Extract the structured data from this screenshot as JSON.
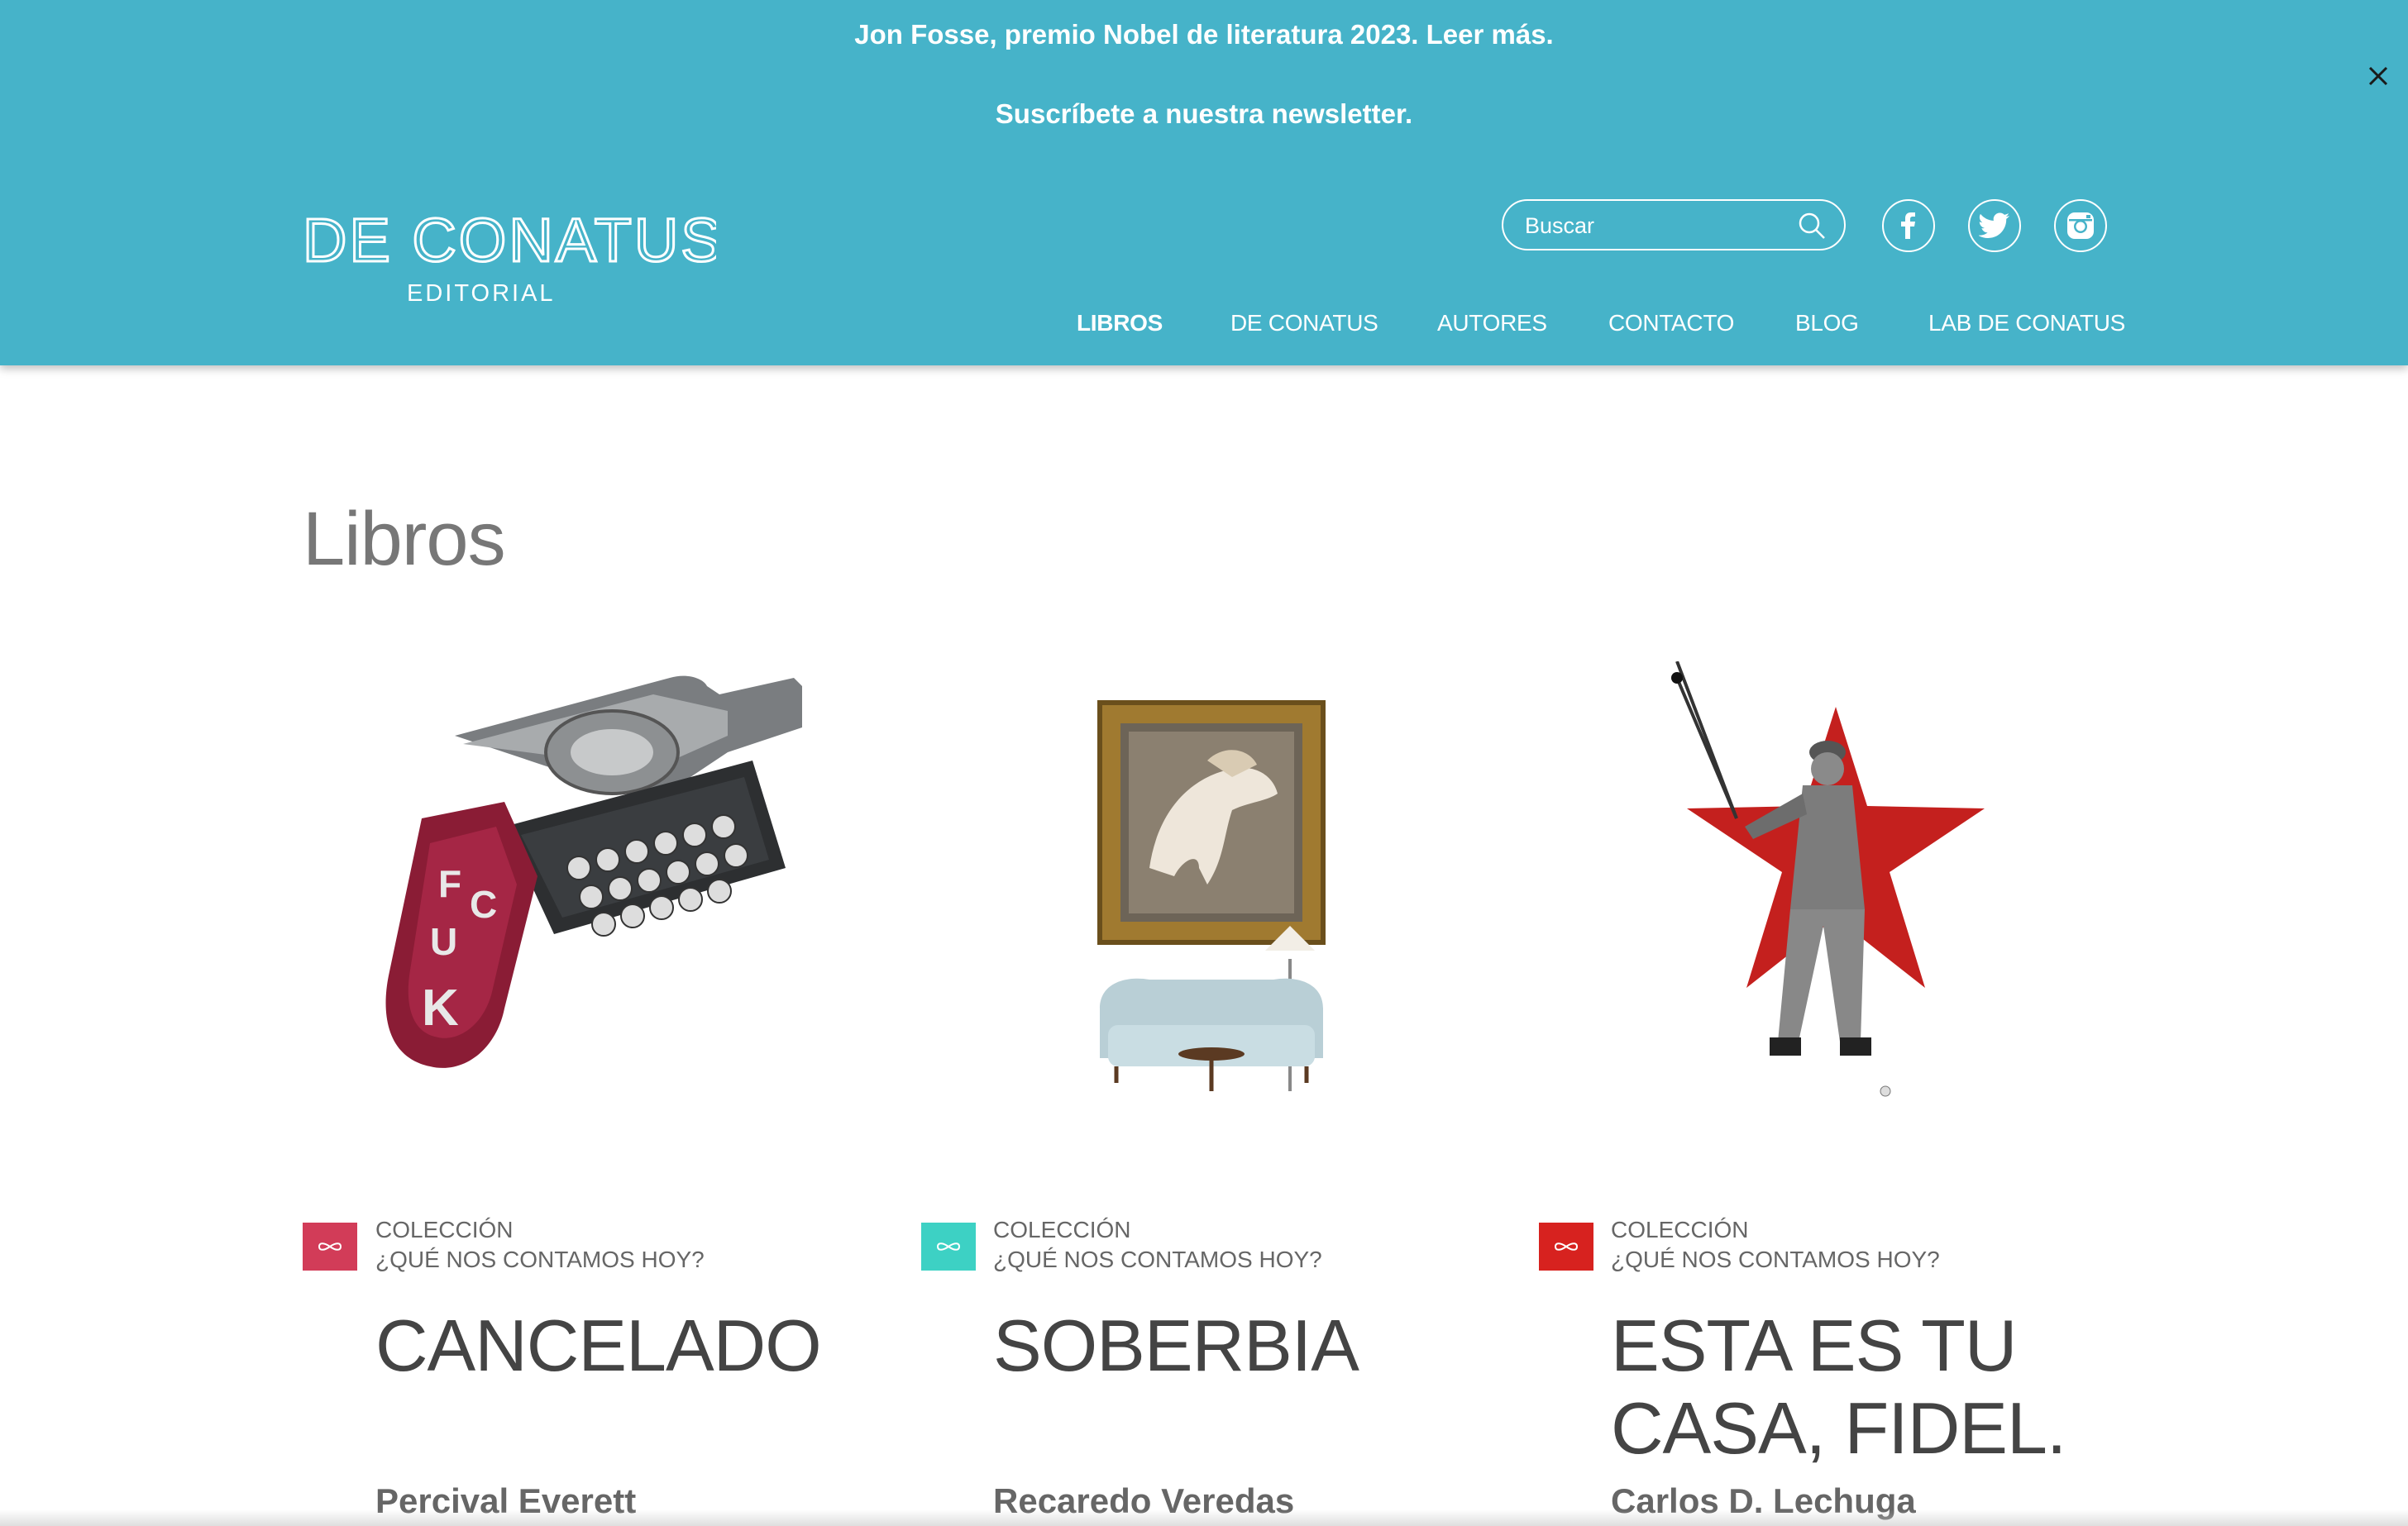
{
  "banner": {
    "line1": "Jon Fosse, premio Nobel de literatura 2023. Leer más.",
    "line2": "Suscríbete a nuestra newsletter."
  },
  "logo": {
    "text_top": "DE CONATUS",
    "text_bottom": "EDITORIAL"
  },
  "search": {
    "placeholder": "Buscar"
  },
  "nav": [
    {
      "label": "LIBROS"
    },
    {
      "label": "DE CONATUS"
    },
    {
      "label": "AUTORES"
    },
    {
      "label": "CONTACTO"
    },
    {
      "label": "BLOG"
    },
    {
      "label": "LAB DE CONATUS"
    }
  ],
  "page": {
    "title": "Libros"
  },
  "books": [
    {
      "collection_label": "COLECCIÓN",
      "collection_name": "¿QUÉ NOS CONTAMOS HOY?",
      "title": "CANCELADO",
      "author": "Percival Everett",
      "badge_color": "#d23c58"
    },
    {
      "collection_label": "COLECCIÓN",
      "collection_name": "¿QUÉ NOS CONTAMOS HOY?",
      "title": "SOBERBIA",
      "author": "Recaredo Veredas",
      "badge_color": "#3dd1c4"
    },
    {
      "collection_label": "COLECCIÓN",
      "collection_name": "¿QUÉ NOS CONTAMOS HOY?",
      "title": "ESTA ES TU CASA, FIDEL.",
      "author": "Carlos D. Lechuga",
      "badge_color": "#d7221f"
    }
  ],
  "colors": {
    "header_bg": "#46b3c9",
    "text_dark": "#444444"
  },
  "icons": [
    "close-icon",
    "search-icon",
    "facebook-icon",
    "twitter-icon",
    "instagram-icon",
    "infinity-icon"
  ]
}
